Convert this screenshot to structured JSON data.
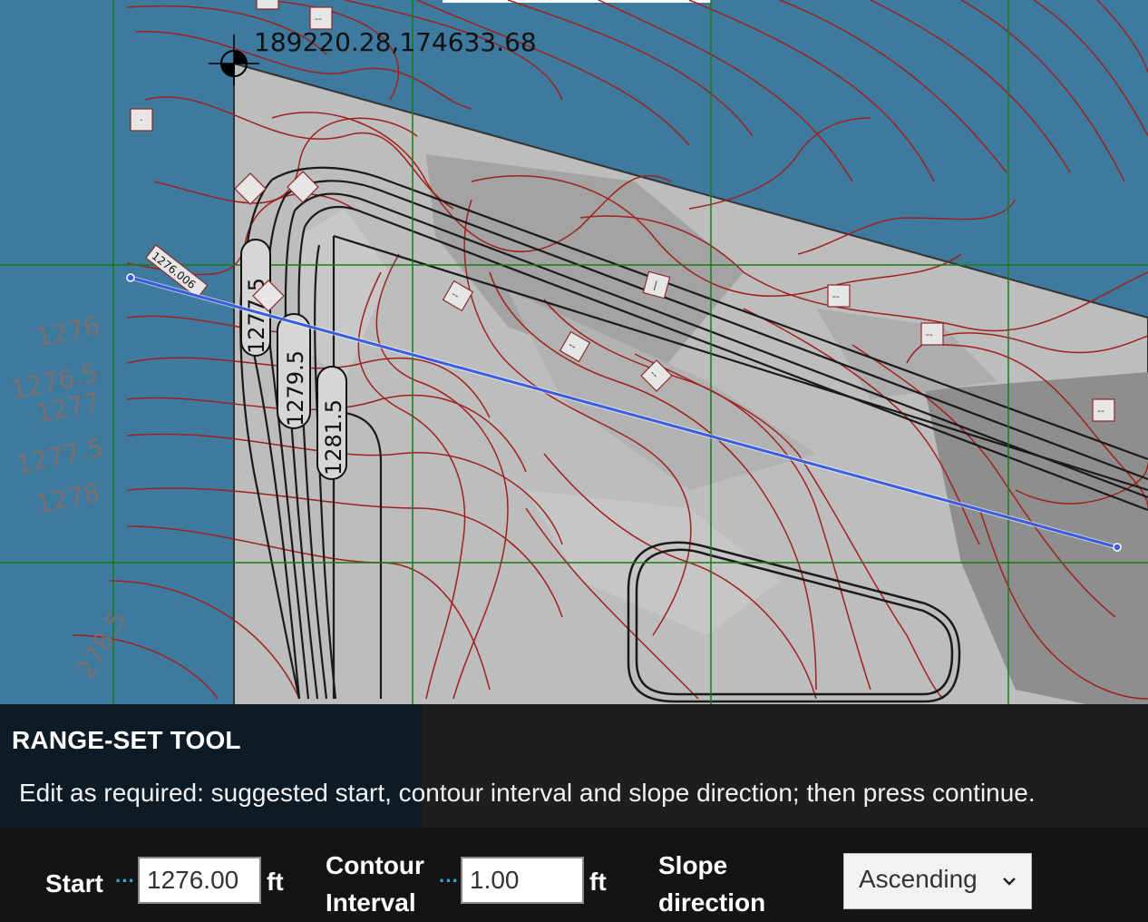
{
  "map": {
    "coordinate": "189220.28,174633.68",
    "elevation_labels": [
      "1276",
      "1276.5",
      "1277",
      "1277.5",
      "1278",
      "278.5"
    ],
    "contour_labels": [
      "1277.5",
      "1279.5",
      "1281.5"
    ],
    "line_start_label": "1276.006",
    "marker_text": "--"
  },
  "panel": {
    "title": "RANGE-SET TOOL",
    "instruction": "Edit as required: suggested start, contour interval and slope direction; then press continue.",
    "start_label": "Start",
    "start_value": "1276.00",
    "start_unit": "ft",
    "interval_label_line1": "Contour",
    "interval_label_line2": "Interval",
    "interval_value": "1.00",
    "interval_unit": "ft",
    "slope_label_line1": "Slope",
    "slope_label_line2": "direction",
    "slope_selected": "Ascending",
    "dots": "···"
  },
  "colors": {
    "water": "#3d7a9e",
    "grid": "#1a7a1a",
    "contour": "#a0201e",
    "section_line": "#3a5ce0"
  }
}
